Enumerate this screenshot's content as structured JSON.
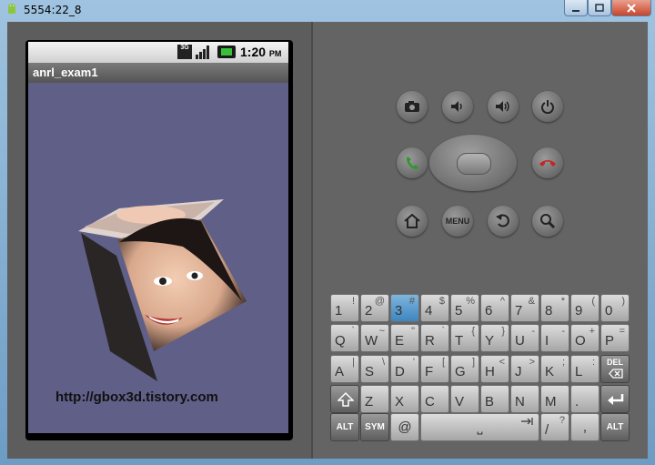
{
  "window": {
    "title": "5554:22_8"
  },
  "phone": {
    "status_bar": {
      "network": "3G",
      "time": "1:20",
      "ampm": "PM"
    },
    "app_title": "anrl_exam1",
    "url_text": "http://gbox3d.tistory.com"
  },
  "controls": {
    "row1": [
      "camera-icon",
      "volume-down-icon",
      "volume-up-icon",
      "power-icon"
    ],
    "row2": [
      "call-icon",
      "dpad",
      "end-call-icon"
    ],
    "row3": [
      "home-icon",
      "menu",
      "back-icon",
      "search-icon"
    ],
    "menu_label": "MENU"
  },
  "keyboard": {
    "row1": [
      {
        "main": "1",
        "alt": "!"
      },
      {
        "main": "2",
        "alt": "@"
      },
      {
        "main": "3",
        "alt": "#"
      },
      {
        "main": "4",
        "alt": "$"
      },
      {
        "main": "5",
        "alt": "%"
      },
      {
        "main": "6",
        "alt": "^"
      },
      {
        "main": "7",
        "alt": "&"
      },
      {
        "main": "8",
        "alt": "*"
      },
      {
        "main": "9",
        "alt": "("
      },
      {
        "main": "0",
        "alt": ")"
      }
    ],
    "row2": [
      {
        "main": "Q",
        "alt": "`"
      },
      {
        "main": "W",
        "alt": "~"
      },
      {
        "main": "E",
        "alt": "\""
      },
      {
        "main": "R",
        "alt": "`"
      },
      {
        "main": "T",
        "alt": "{"
      },
      {
        "main": "Y",
        "alt": "}"
      },
      {
        "main": "U",
        "alt": "-"
      },
      {
        "main": "I",
        "alt": "-"
      },
      {
        "main": "O",
        "alt": "+"
      },
      {
        "main": "P",
        "alt": "="
      }
    ],
    "row3": [
      {
        "main": "A",
        "alt": "|"
      },
      {
        "main": "S",
        "alt": "\\"
      },
      {
        "main": "D",
        "alt": "'"
      },
      {
        "main": "F",
        "alt": "["
      },
      {
        "main": "G",
        "alt": "]"
      },
      {
        "main": "H",
        "alt": "<"
      },
      {
        "main": "J",
        "alt": ">"
      },
      {
        "main": "K",
        "alt": ";"
      },
      {
        "main": "L",
        "alt": ":"
      }
    ],
    "del_label": "DEL",
    "row4": [
      {
        "main": "Z",
        "alt": ""
      },
      {
        "main": "X",
        "alt": ""
      },
      {
        "main": "C",
        "alt": ""
      },
      {
        "main": "V",
        "alt": ""
      },
      {
        "main": "B",
        "alt": ""
      },
      {
        "main": "N",
        "alt": ""
      },
      {
        "main": "M",
        "alt": ""
      },
      {
        "main": ".",
        "alt": ""
      }
    ],
    "alt_label": "ALT",
    "sym_label": "SYM",
    "at_label": "@",
    "space_label": "⎵",
    "slash_main": "/",
    "slash_alt": "?",
    "comma_label": ","
  },
  "colors": {
    "screen_bg": "#5f5f88",
    "highlight_key": "#3d86bf"
  }
}
